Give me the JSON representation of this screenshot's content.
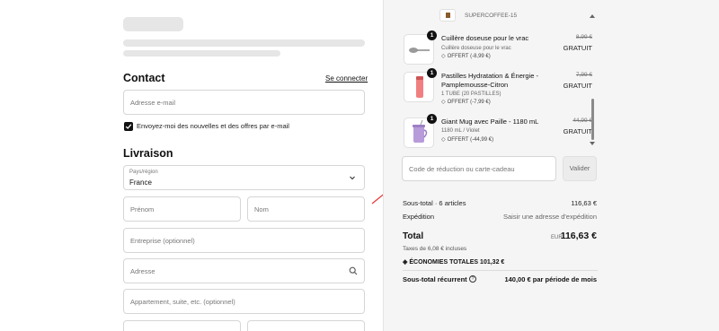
{
  "contact": {
    "heading": "Contact",
    "login_link": "Se connecter",
    "email_placeholder": "Adresse e-mail",
    "newsletter_label": "Envoyez-moi des nouvelles et des offres par e-mail",
    "newsletter_checked": true
  },
  "delivery": {
    "heading": "Livraison",
    "country_label": "Pays/région",
    "country_value": "France",
    "first_name_placeholder": "Prénom",
    "last_name_placeholder": "Nom",
    "company_placeholder": "Entreprise (optionnel)",
    "address_placeholder": "Adresse",
    "apartment_placeholder": "Appartement, suite, etc. (optionnel)"
  },
  "cart": {
    "top_item_label": "SUPERCOFFEE-15",
    "items": [
      {
        "quantity": "1",
        "name": "Cuillère doseuse pour le vrac",
        "variant": "Cuillère doseuse pour le vrac",
        "offer": "OFFERT (-8,99 €)",
        "original_price": "8,99 €",
        "price": "GRATUIT",
        "icon": "scoop-icon"
      },
      {
        "quantity": "1",
        "name": "Pastilles Hydratation & Énergie - Pamplemousse-Citron",
        "variant": "1 TUBE (20 PASTILLES)",
        "offer": "OFFERT (-7,99 €)",
        "original_price": "7,99 €",
        "price": "GRATUIT",
        "icon": "tube-icon"
      },
      {
        "quantity": "1",
        "name": "Giant Mug avec Paille - 1180 mL",
        "variant": "1180 mL / Violet",
        "offer": "OFFERT (-44,99 €)",
        "original_price": "44,99 €",
        "price": "GRATUIT",
        "icon": "mug-icon"
      }
    ]
  },
  "discount": {
    "placeholder": "Code de réduction ou carte-cadeau",
    "apply_label": "Valider"
  },
  "summary": {
    "subtotal_label": "Sous-total · 6 articles",
    "subtotal_value": "116,63 €",
    "shipping_label": "Expédition",
    "shipping_value": "Saisir une adresse d'expédition",
    "total_label": "Total",
    "currency": "EUR",
    "total_value": "116,63 €",
    "tax_note": "Taxes de 6,08 € incluses",
    "savings_label": "ÉCONOMIES TOTALES",
    "savings_value": "101,32 €",
    "recurring_label": "Sous-total récurrent",
    "recurring_value": "140,00 € par période de mois"
  },
  "colors": {
    "accent": "#111111",
    "panel_bg": "#f5f5f5",
    "annotation_arrow": "#e53935"
  }
}
